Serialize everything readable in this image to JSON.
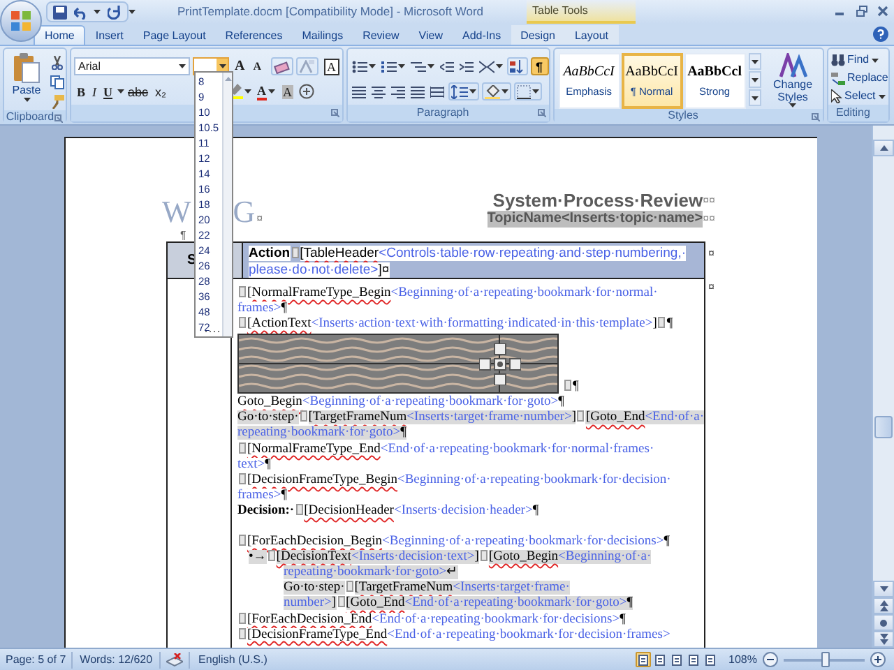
{
  "window": {
    "title": "PrintTemplate.docm [Compatibility Mode] - Microsoft Word",
    "context_group": "Table Tools"
  },
  "tabs": [
    {
      "label": "Home",
      "selected": true,
      "contextual": false
    },
    {
      "label": "Insert",
      "selected": false,
      "contextual": false
    },
    {
      "label": "Page Layout",
      "selected": false,
      "contextual": false
    },
    {
      "label": "References",
      "selected": false,
      "contextual": false
    },
    {
      "label": "Mailings",
      "selected": false,
      "contextual": false
    },
    {
      "label": "Review",
      "selected": false,
      "contextual": false
    },
    {
      "label": "View",
      "selected": false,
      "contextual": false
    },
    {
      "label": "Add-Ins",
      "selected": false,
      "contextual": false
    },
    {
      "label": "Design",
      "selected": false,
      "contextual": true
    },
    {
      "label": "Layout",
      "selected": false,
      "contextual": true
    }
  ],
  "ribbon": {
    "clipboard": {
      "paste": "Paste",
      "label": "Clipboard"
    },
    "font": {
      "name": "Arial",
      "sizes": [
        "8",
        "9",
        "10",
        "10.5",
        "11",
        "12",
        "14",
        "16",
        "18",
        "20",
        "22",
        "24",
        "26",
        "28",
        "36",
        "48",
        "72"
      ],
      "format_buttons": [
        {
          "kind": "bold",
          "label": "B"
        },
        {
          "kind": "italic",
          "label": "I"
        },
        {
          "kind": "underline",
          "label": "U"
        },
        {
          "kind": "strike",
          "label": "abc"
        },
        {
          "kind": "subscript",
          "label": "x₂"
        }
      ],
      "letter_buttons": [
        {
          "kind": "grow",
          "label": "A"
        },
        {
          "kind": "shrink",
          "label": "A"
        },
        {
          "kind": "border",
          "label": "A"
        },
        {
          "kind": "color",
          "label": "A"
        },
        {
          "kind": "shading",
          "label": "A"
        }
      ]
    },
    "paragraph": {
      "label": "Paragraph",
      "show_marks": {
        "label": "¶",
        "selected": true
      }
    },
    "styles": {
      "label": "Styles",
      "items": [
        {
          "kind": "emphasis",
          "preview": "AaBbCcI",
          "name": "Emphasis",
          "selected": false
        },
        {
          "kind": "normal",
          "preview": "AaBbCcI",
          "name": "¶ Normal",
          "selected": true
        },
        {
          "kind": "strong",
          "preview": "AaBbCcl",
          "name": "Strong",
          "selected": false
        }
      ],
      "change_styles": "Change Styles"
    },
    "editing": {
      "label": "Editing",
      "items": [
        {
          "kind": "find",
          "label": "Find",
          "dropdown": true
        },
        {
          "kind": "replace",
          "label": "Replace",
          "dropdown": false
        },
        {
          "kind": "select",
          "label": "Select",
          "dropdown": true
        }
      ]
    }
  },
  "document": {
    "logo": {
      "left": "W",
      "right": "G",
      "mark": "¤"
    },
    "title": "System·Process·Review",
    "title_marks": "¤¤",
    "topic": "TopicName<Inserts·topic·name>",
    "topic_marks": "¤¤",
    "pilcrow": "¶",
    "table": {
      "header": {
        "left": "S",
        "end_mark": "¤",
        "lines": [
          {
            "kind": "text",
            "shaded": false,
            "segments": [
              {
                "kind": "bold",
                "text": "Action"
              },
              {
                "kind": "handle"
              },
              {
                "kind": "field",
                "text": "[TableHeader"
              },
              {
                "kind": "hint",
                "text": "<Controls·table·row·repeating·and·step·numbering,·"
              }
            ]
          },
          {
            "kind": "text",
            "shaded": false,
            "segments": [
              {
                "kind": "hint",
                "text": "please·do·not·delete>"
              },
              {
                "kind": "mark",
                "text": "]¤"
              }
            ]
          }
        ]
      },
      "body": {
        "end_mark": "¤",
        "lines": [
          {
            "kind": "text",
            "shaded": false,
            "segments": [
              {
                "kind": "handle"
              },
              {
                "kind": "field",
                "text": "[NormalFrameType_Begin"
              },
              {
                "kind": "hint",
                "text": "<Beginning·of·a·repeating·bookmark·for·normal·"
              }
            ]
          },
          {
            "kind": "text",
            "shaded": false,
            "segments": [
              {
                "kind": "hint",
                "text": "frames>"
              },
              {
                "kind": "mark",
                "text": "¶"
              }
            ]
          },
          {
            "kind": "text",
            "shaded": false,
            "segments": [
              {
                "kind": "handle"
              },
              {
                "kind": "field",
                "text": "[ActionText"
              },
              {
                "kind": "hint",
                "text": "<Inserts·action·text·with·formatting·indicated·in·this·template>"
              },
              {
                "kind": "mark",
                "text": "]"
              },
              {
                "kind": "handle"
              },
              {
                "kind": "mark",
                "text": "¶"
              }
            ]
          },
          {
            "kind": "picture",
            "shaded": false,
            "segments": [
              {
                "kind": "handle"
              },
              {
                "kind": "mark",
                "text": "¶"
              }
            ]
          },
          {
            "kind": "text",
            "shaded": false,
            "segments": [
              {
                "kind": "field",
                "text": "Goto_Begin"
              },
              {
                "kind": "hint",
                "text": "<Beginning·of·a·repeating·bookmark·for·goto>"
              },
              {
                "kind": "mark",
                "text": "¶"
              }
            ]
          },
          {
            "kind": "text",
            "shaded": true,
            "segments": [
              {
                "kind": "text",
                "text": "Go·to·step·"
              },
              {
                "kind": "handle"
              },
              {
                "kind": "field",
                "text": "[TargetFrameNum"
              },
              {
                "kind": "hint",
                "text": "<Inserts·target·frame·number>"
              },
              {
                "kind": "mark",
                "text": "]"
              },
              {
                "kind": "handle"
              },
              {
                "kind": "field",
                "text": "[Goto_End"
              },
              {
                "kind": "hint",
                "text": "<End·of·a·"
              }
            ]
          },
          {
            "kind": "text",
            "shaded": true,
            "segments": [
              {
                "kind": "hint",
                "text": "repeating·bookmark·for·goto>"
              },
              {
                "kind": "mark",
                "text": "¶"
              }
            ]
          },
          {
            "kind": "text",
            "shaded": false,
            "segments": [
              {
                "kind": "handle"
              },
              {
                "kind": "field",
                "text": "[NormalFrameType_End"
              },
              {
                "kind": "hint",
                "text": "<End·of·a·repeating·bookmark·for·normal·frames·"
              }
            ]
          },
          {
            "kind": "text",
            "shaded": false,
            "segments": [
              {
                "kind": "hint",
                "text": "text>"
              },
              {
                "kind": "mark",
                "text": "¶"
              }
            ]
          },
          {
            "kind": "text",
            "shaded": false,
            "segments": [
              {
                "kind": "handle"
              },
              {
                "kind": "field",
                "text": "[DecisionFrameType_Begin"
              },
              {
                "kind": "hint",
                "text": "<Beginning·of·a·repeating·bookmark·for·decision·"
              }
            ]
          },
          {
            "kind": "text",
            "shaded": false,
            "segments": [
              {
                "kind": "hint",
                "text": "frames>"
              },
              {
                "kind": "mark",
                "text": "¶"
              }
            ]
          },
          {
            "kind": "text",
            "shaded": false,
            "segments": [
              {
                "kind": "bold",
                "text": "Decision:·"
              },
              {
                "kind": "handle"
              },
              {
                "kind": "field",
                "text": "[DecisionHeader"
              },
              {
                "kind": "hint",
                "text": "<Inserts·decision·header>"
              },
              {
                "kind": "mark",
                "text": "¶"
              }
            ]
          },
          {
            "kind": "blank"
          },
          {
            "kind": "text",
            "shaded": false,
            "segments": [
              {
                "kind": "handle"
              },
              {
                "kind": "field",
                "text": "[ForEachDecision_Begin"
              },
              {
                "kind": "hint",
                "text": "<Beginning·of·a·repeating·bookmark·for·decisions>"
              },
              {
                "kind": "mark",
                "text": "¶"
              }
            ]
          },
          {
            "kind": "bullet",
            "shaded": true,
            "segments": [
              {
                "kind": "text",
                "text": "•→"
              },
              {
                "kind": "handle"
              },
              {
                "kind": "field",
                "text": "[DecisionText"
              },
              {
                "kind": "hint",
                "text": "<Inserts·decision·text>"
              },
              {
                "kind": "mark",
                "text": "]"
              },
              {
                "kind": "handle"
              },
              {
                "kind": "field",
                "text": "[Goto_Begin"
              },
              {
                "kind": "hint",
                "text": "<Beginning·of·a·"
              }
            ]
          },
          {
            "kind": "continuation",
            "shaded": true,
            "segments": [
              {
                "kind": "hint",
                "text": "repeating·bookmark·for·goto>"
              },
              {
                "kind": "mark",
                "text": "↵"
              }
            ]
          },
          {
            "kind": "continuation",
            "shaded": true,
            "segments": [
              {
                "kind": "text",
                "text": "Go·to·step·"
              },
              {
                "kind": "handle"
              },
              {
                "kind": "field",
                "text": "[TargetFrameNum"
              },
              {
                "kind": "hint",
                "text": "<Inserts·target·frame·"
              }
            ]
          },
          {
            "kind": "continuation",
            "shaded": true,
            "segments": [
              {
                "kind": "hint",
                "text": "number>"
              },
              {
                "kind": "mark",
                "text": "]"
              },
              {
                "kind": "handle"
              },
              {
                "kind": "field",
                "text": "[Goto_End"
              },
              {
                "kind": "hint",
                "text": "<End·of·a·repeating·bookmark·for·goto>"
              },
              {
                "kind": "mark",
                "text": "¶"
              }
            ]
          },
          {
            "kind": "text",
            "shaded": false,
            "segments": [
              {
                "kind": "handle"
              },
              {
                "kind": "field",
                "text": "[ForEachDecision_End"
              },
              {
                "kind": "hint",
                "text": "<End·of·a·repeating·bookmark·for·decisions>"
              },
              {
                "kind": "mark",
                "text": "¶"
              }
            ]
          },
          {
            "kind": "text",
            "shaded": false,
            "segments": [
              {
                "kind": "handle"
              },
              {
                "kind": "field",
                "text": "[DecisionFrameType_End"
              },
              {
                "kind": "hint",
                "text": "<End·of·a·repeating·bookmark·for·decision·frames>"
              }
            ]
          }
        ]
      }
    }
  },
  "status_bar": {
    "page": "Page: 5 of 7",
    "words": "Words: 12/620",
    "language": "English (U.S.)",
    "views": [
      {
        "selected": true
      },
      {
        "selected": false
      },
      {
        "selected": false
      },
      {
        "selected": false
      },
      {
        "selected": false
      }
    ],
    "zoom": "108%",
    "zoom_slider": {
      "level": 0.52
    }
  }
}
